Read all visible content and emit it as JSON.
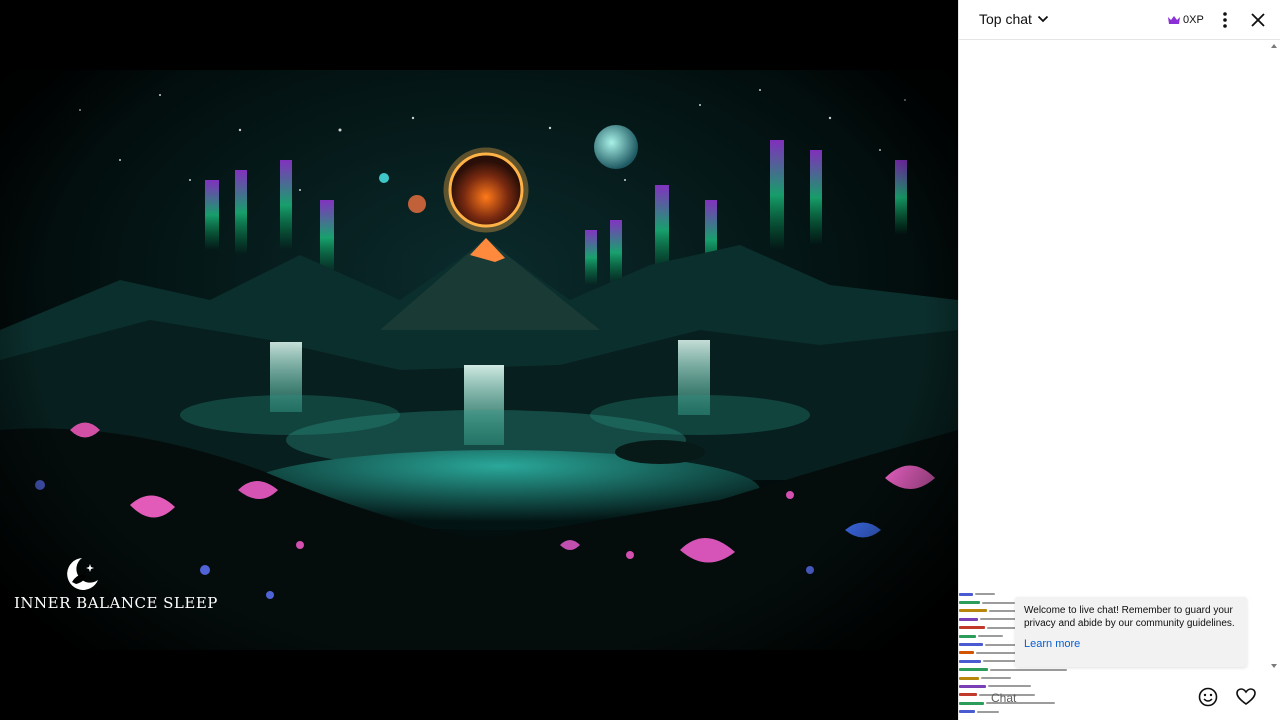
{
  "video": {
    "channel_brand": "INNER BALANCE SLEEP",
    "brand_logo_icon": "moon-swan-logo-icon"
  },
  "chat": {
    "mode_label": "Top chat",
    "mode_icon": "chevron-down-icon",
    "xp_label": "0XP",
    "xp_icon": "crown-icon",
    "xp_color": "#8b2fd6",
    "menu_icon": "more-vert-icon",
    "close_icon": "close-icon",
    "welcome_message": "Welcome to live chat! Remember to guard your privacy and abide by our community guidelines.",
    "learn_more": "Learn more",
    "link_color": "#065fd4",
    "input_placeholder": "Chat",
    "emoji_icon": "emoji-icon",
    "heart_icon": "heart-icon"
  }
}
